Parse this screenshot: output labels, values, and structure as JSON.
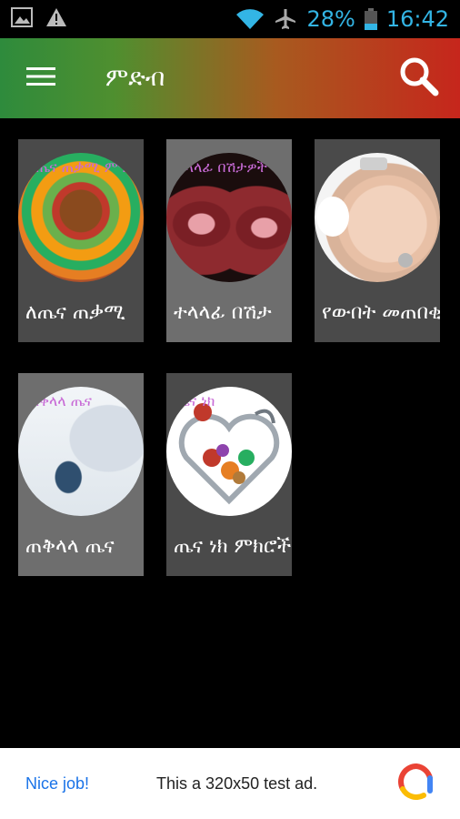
{
  "status_bar": {
    "battery_percent": "28%",
    "time": "16:42",
    "icons": [
      "image-icon",
      "warning-icon",
      "wifi-icon",
      "airplane-icon",
      "battery-icon"
    ]
  },
  "app_bar": {
    "title": "ምድብ",
    "menu_icon": "hamburger-menu-icon",
    "search_icon": "search-icon"
  },
  "categories": [
    {
      "label": "ለጤና ጠቃሚ",
      "thumb_text": "ለጤና ጠቃሚ ምግቦች"
    },
    {
      "label": "ተላላፊ በሽታ",
      "thumb_text": "ተላላፊ በሽታዎች"
    },
    {
      "label": "የውበት መጠበቂያ",
      "thumb_text": ""
    },
    {
      "label": "ጠቅላላ ጤና",
      "thumb_text": "ጠቅላላ ጤና"
    },
    {
      "label": "ጤና ነክ ምክሮች",
      "thumb_text": "ጤና ነክ"
    }
  ],
  "ad": {
    "left_text": "Nice job!",
    "center_text": "This a 320x50 test ad."
  }
}
